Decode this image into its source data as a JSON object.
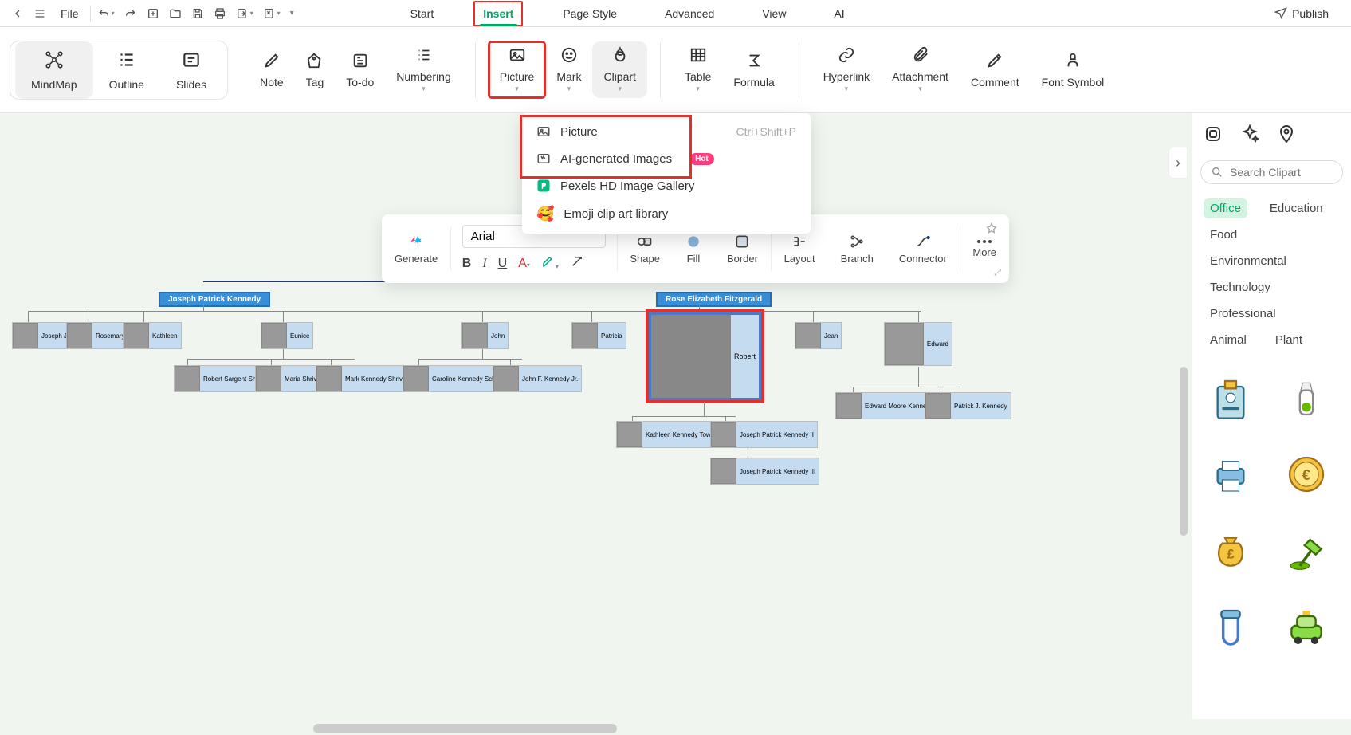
{
  "topbar": {
    "file_label": "File"
  },
  "menu": {
    "items": [
      "Start",
      "Insert",
      "Page Style",
      "Advanced",
      "View",
      "AI"
    ],
    "active": "Insert"
  },
  "publish_label": "Publish",
  "ribbon": {
    "view_group": [
      "MindMap",
      "Outline",
      "Slides"
    ],
    "tools": [
      "Note",
      "Tag",
      "To-do",
      "Numbering",
      "Picture",
      "Mark",
      "Clipart",
      "Table",
      "Formula",
      "Hyperlink",
      "Attachment",
      "Comment",
      "Font Symbol"
    ]
  },
  "dropdown": {
    "picture": {
      "label": "Picture",
      "shortcut": "Ctrl+Shift+P"
    },
    "ai": {
      "label": "AI-generated Images",
      "badge": "Hot"
    },
    "pexels": "Pexels HD Image Gallery",
    "emoji": "Emoji clip art library"
  },
  "formatbar": {
    "generate": "Generate",
    "font": "Arial",
    "shape": "Shape",
    "fill": "Fill",
    "border": "Border",
    "layout": "Layout",
    "branch": "Branch",
    "connector": "Connector",
    "more": "More"
  },
  "sidepanel": {
    "search_placeholder": "Search Clipart",
    "categories": [
      "Office",
      "Education",
      "Food",
      "Environmental",
      "Technology",
      "Professional",
      "Animal",
      "Plant"
    ],
    "active": "Office"
  },
  "tree": {
    "parent1": "Joseph Patrick Kennedy",
    "parent2": "Rose Elizabeth Fitzgerald",
    "gen1": [
      "Joseph Jr.",
      "Rosemary",
      "Kathleen",
      "Eunice",
      "John",
      "Patricia",
      "Robert",
      "Jean",
      "Edward"
    ],
    "gen2a": [
      "Robert Sargent Shriver III",
      "Maria Shriver",
      "Mark Kennedy Shriver"
    ],
    "gen2b": [
      "Caroline Kennedy Schlossberg",
      "John F. Kennedy Jr."
    ],
    "gen2c": [
      "Edward Moore Kennedy Jr.",
      "Patrick J. Kennedy"
    ],
    "gen2d": [
      "Kathleen Kennedy Townsend",
      "Joseph Patrick Kennedy II"
    ],
    "gen2e": [
      "Joseph Patrick Kennedy III"
    ]
  }
}
